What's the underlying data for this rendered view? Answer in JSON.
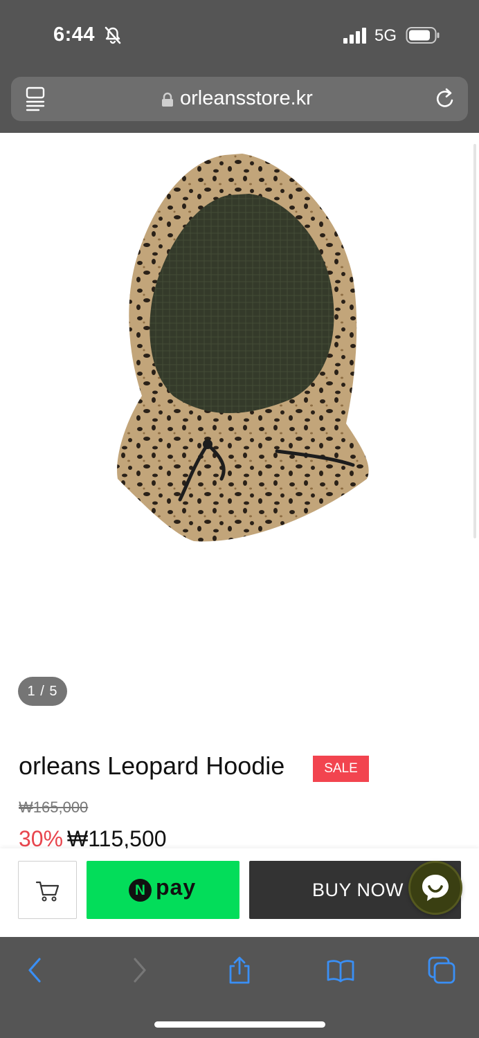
{
  "status_bar": {
    "time": "6:44",
    "network": "5G",
    "icons": [
      "bell-muted-icon",
      "signal-icon",
      "battery-icon"
    ]
  },
  "url_bar": {
    "url": "orleansstore.kr",
    "icons": [
      "reader-icon",
      "lock-icon",
      "reload-icon"
    ]
  },
  "product": {
    "image_counter": "1 / 5",
    "title": "orleans Leopard Hoodie",
    "badge": "SALE",
    "original_price": "₩165,000",
    "discount": "30%",
    "sale_price": "₩115,500"
  },
  "actions": {
    "npay_mark": "N",
    "npay_label": "pay",
    "buy_label": "BUY NOW",
    "icons": [
      "cart-icon",
      "chat-icon"
    ]
  },
  "colors": {
    "browser_chrome": "#555555",
    "sale_red": "#f2444f",
    "npay_green": "#03dd5a",
    "buy_button": "#333333",
    "toolbar_blue": "#3a8ff5"
  },
  "toolbar": {
    "icons": [
      "back-icon",
      "forward-icon",
      "share-icon",
      "bookmarks-icon",
      "tabs-icon"
    ]
  }
}
